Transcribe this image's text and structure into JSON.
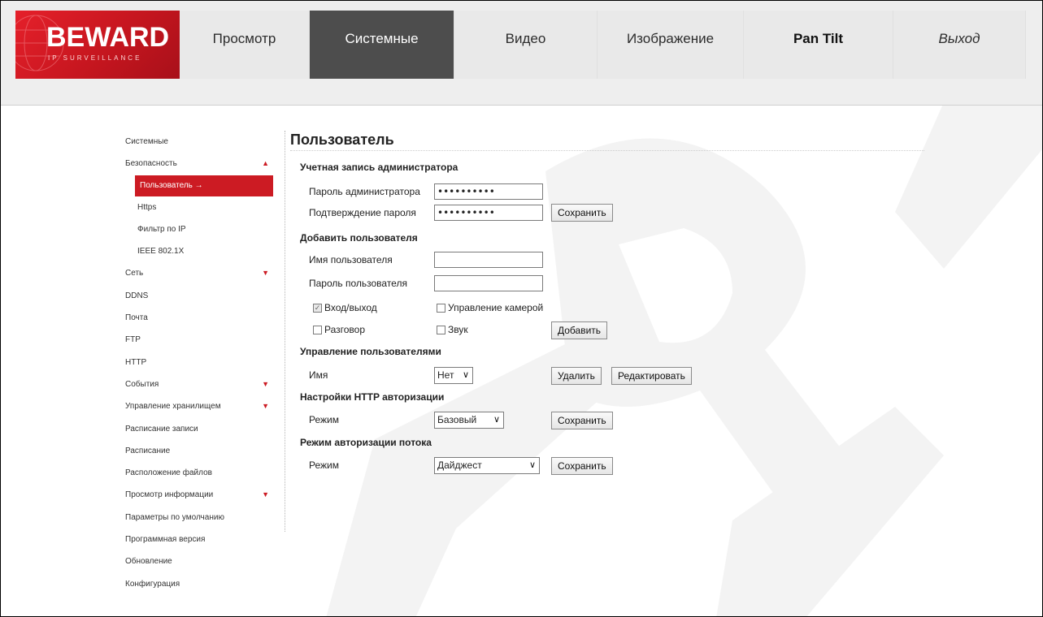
{
  "brand": {
    "name": "BEWARD",
    "tagline": "IP SURVEILLANCE"
  },
  "nav": {
    "items": [
      {
        "label": "Просмотр"
      },
      {
        "label": "Системные"
      },
      {
        "label": "Видео"
      },
      {
        "label": "Изображение"
      },
      {
        "label": "Pan Tilt"
      },
      {
        "label": "Выход"
      }
    ],
    "active": "Системные"
  },
  "sidebar": {
    "items": [
      {
        "label": "Системные"
      },
      {
        "label": "Безопасность"
      },
      {
        "label": "Пользователь →"
      },
      {
        "label": "Https"
      },
      {
        "label": "Фильтр по IP"
      },
      {
        "label": "IEEE 802.1X"
      },
      {
        "label": "Сеть"
      },
      {
        "label": "DDNS"
      },
      {
        "label": "Почта"
      },
      {
        "label": "FTP"
      },
      {
        "label": "HTTP"
      },
      {
        "label": "События"
      },
      {
        "label": "Управление хранилищем"
      },
      {
        "label": "Расписание записи"
      },
      {
        "label": "Расписание"
      },
      {
        "label": "Расположение файлов"
      },
      {
        "label": "Просмотр информации"
      },
      {
        "label": "Параметры по умолчанию"
      },
      {
        "label": "Программная версия"
      },
      {
        "label": "Обновление"
      },
      {
        "label": "Конфигурация"
      }
    ],
    "arrow_up": "▲",
    "arrow_down": "▼"
  },
  "page": {
    "title": "Пользователь",
    "admin": {
      "section": "Учетная запись администратора",
      "password_label": "Пароль администратора",
      "password_value": "••••••••••",
      "confirm_label": "Подтверждение пароля",
      "confirm_value": "••••••••••",
      "save_label": "Сохранить"
    },
    "add_user": {
      "section": "Добавить пользователя",
      "name_label": "Имя пользователя",
      "name_value": "",
      "password_label": "Пароль пользователя",
      "password_value": "",
      "login_label": "Вход/выход",
      "login_checked": true,
      "camera_label": "Управление камерой",
      "camera_checked": false,
      "talk_label": "Разговор",
      "talk_checked": false,
      "sound_label": "Звук",
      "sound_checked": false,
      "add_label": "Добавить"
    },
    "manage": {
      "section": "Управление пользователями",
      "name_label": "Имя",
      "name_select": "Нет",
      "delete_label": "Удалить",
      "edit_label": "Редактировать"
    },
    "http_auth": {
      "section": "Настройки HTTP авторизации",
      "mode_label": "Режим",
      "mode_select": "Базовый",
      "save_label": "Сохранить"
    },
    "stream_auth": {
      "section": "Режим авторизации потока",
      "mode_label": "Режим",
      "mode_select": "Дайджест",
      "save_label": "Сохранить"
    }
  },
  "colors": {
    "brand_red": "#cc1b23",
    "nav_active": "#4d4d4d",
    "header_bg": "#eeeeee"
  }
}
